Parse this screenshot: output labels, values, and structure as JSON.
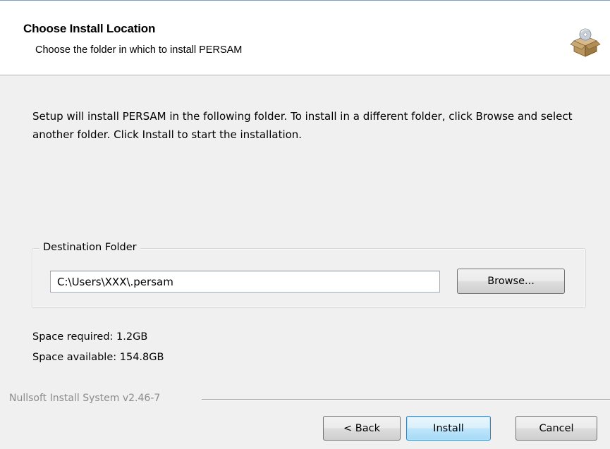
{
  "header": {
    "title": "Choose Install Location",
    "subtitle": "Choose the folder in which to install PERSAM",
    "icon": "installer-box-icon"
  },
  "body": {
    "intro": "Setup will install PERSAM in the following folder. To install in a different folder, click Browse and select another folder. Click Install to start the installation.",
    "destination": {
      "group_label": "Destination Folder",
      "path_value": "C:\\Users\\XXX\\.persam",
      "browse_label": "Browse..."
    },
    "space_required": "Space required: 1.2GB",
    "space_available": "Space available: 154.8GB"
  },
  "footer": {
    "branding": "Nullsoft Install System v2.46-7",
    "back_label": "< Back",
    "install_label": "Install",
    "cancel_label": "Cancel"
  },
  "colors": {
    "header_bg": "#ffffff",
    "dialog_bg": "#f0f0f0",
    "default_button_border": "#3c7fb1",
    "branding_text": "#8b8b8b"
  }
}
